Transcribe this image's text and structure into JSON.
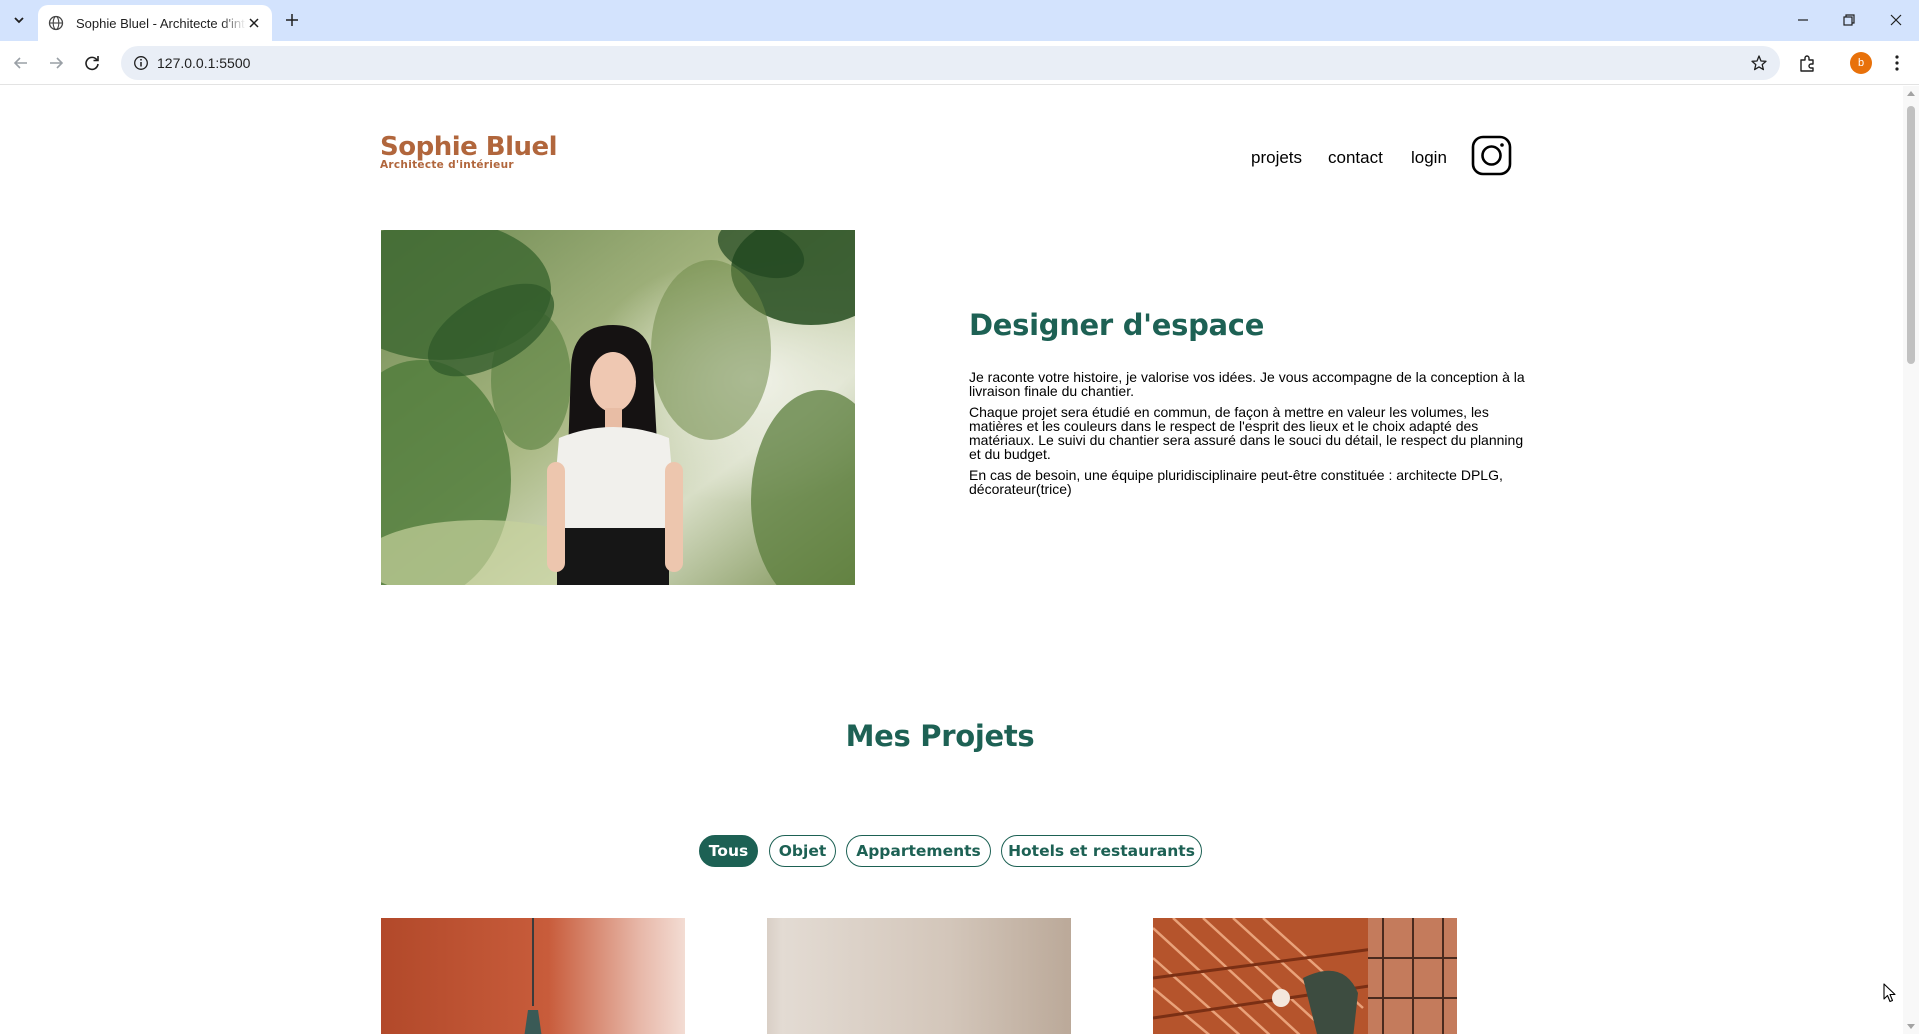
{
  "browser": {
    "tab_title": "Sophie Bluel - Architecte d'intérieur",
    "url": "127.0.0.1:5500",
    "profile_initial": "b"
  },
  "site": {
    "brand_name": "Sophie Bluel",
    "brand_subtitle": "Architecte d'intérieur",
    "nav": {
      "projets": "projets",
      "contact": "contact",
      "login": "login"
    },
    "intro": {
      "title": "Designer d'espace",
      "paragraphs": [
        "Je raconte votre histoire, je valorise vos idées. Je vous accompagne de la conception à la livraison finale du chantier.",
        "Chaque projet sera étudié en commun, de façon à mettre en valeur les volumes, les matières et les couleurs dans le respect de l'esprit des lieux et le choix adapté des matériaux. Le suivi du chantier sera assuré dans le souci du détail, le respect du planning et du budget.",
        "En cas de besoin, une équipe pluridisciplinaire peut-être constituée : architecte DPLG, décorateur(trice)"
      ]
    },
    "projects": {
      "title": "Mes Projets",
      "filters": [
        "Tous",
        "Objet",
        "Appartements",
        "Hotels et restaurants"
      ],
      "active_filter": "Tous"
    }
  },
  "colors": {
    "brand": "#b1663c",
    "accent": "#1d6154",
    "chrome_tabbar": "#d3e3fd",
    "omnibox": "#e9eef6"
  },
  "icons": [
    "tab-list-icon",
    "globe-icon",
    "close-icon",
    "plus-icon",
    "minimize-icon",
    "restore-icon",
    "back-icon",
    "forward-icon",
    "reload-icon",
    "info-icon",
    "star-icon",
    "extensions-icon",
    "kebab-menu-icon",
    "instagram-icon",
    "mouse-cursor-icon"
  ]
}
